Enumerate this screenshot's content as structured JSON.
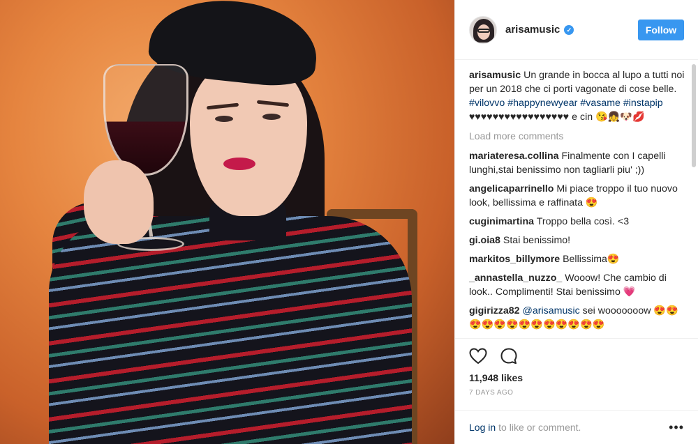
{
  "post": {
    "username": "arisamusic",
    "verified": true,
    "follow_label": "Follow"
  },
  "caption": {
    "user": "arisamusic",
    "text": "Un grande in bocca al lupo a tutti noi per un 2018 che ci porti vagonate di cose belle.",
    "tags": [
      "#vilovvo",
      "#happynewyear",
      "#vasame",
      "#instapip"
    ],
    "tail": "♥♥♥♥♥♥♥♥♥♥♥♥♥♥♥♥♥ e cin 😘👧🐶💋"
  },
  "load_more": "Load more comments",
  "comments": [
    {
      "user": "mariateresa.collina",
      "text": "Finalmente con I capelli lunghi,stai benissimo non tagliarli piu' ;))"
    },
    {
      "user": "angelicaparrinello",
      "text": "Mi piace troppo il tuo nuovo look, bellissima e raffinata 😍"
    },
    {
      "user": "cuginimartina",
      "text": "Troppo bella così. <3"
    },
    {
      "user": "gi.oia8",
      "text": "Stai benissimo!"
    },
    {
      "user": "markitos_billymore",
      "text": "Bellissima😍"
    },
    {
      "user": "_annastella_nuzzo_",
      "text": "Wooow! Che cambio di look.. Complimenti! Stai benissimo 💗"
    },
    {
      "user": "gigirizza82",
      "mention": "@arisamusic",
      "text": "sei wooooooow 😍😍😍😍😍😍😍😍😍😍😍😍😍"
    }
  ],
  "likes": "11,948 likes",
  "timestamp": "7 DAYS AGO",
  "footer": {
    "login": "Log in",
    "rest": "to like or comment.",
    "more": "•••"
  },
  "icons": {
    "like": "heart-icon",
    "comment": "comment-icon",
    "more": "more-options-icon",
    "verified": "verified-badge-icon"
  },
  "colors": {
    "accent": "#3897f0",
    "link": "#003569",
    "muted": "#999999"
  }
}
